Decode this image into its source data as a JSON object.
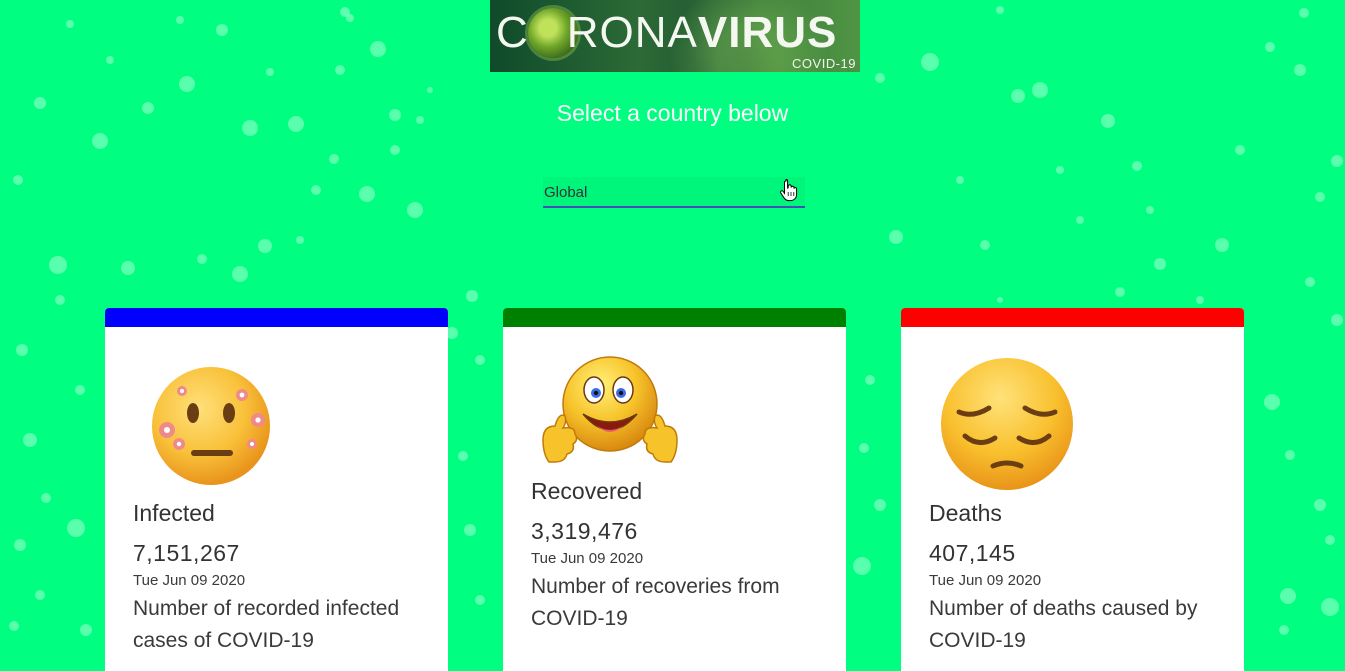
{
  "logo": {
    "title_thin": "C",
    "title_mid": "RONA",
    "title_bold": "VIRUS",
    "subtitle": "COVID-19"
  },
  "heading": "Select a country below",
  "country_select": {
    "selected": "Global"
  },
  "cards": [
    {
      "label": "Infected",
      "count": "7,151,267",
      "date": "Tue Jun 09 2020",
      "description": "Number of recorded infected cases of COVID-19",
      "accent": "#0000ff",
      "icon": "sick-face-emoji-icon"
    },
    {
      "label": "Recovered",
      "count": "3,319,476",
      "date": "Tue Jun 09 2020",
      "description": "Number of recoveries from COVID-19",
      "accent": "#008000",
      "icon": "thumbs-up-smiley-icon"
    },
    {
      "label": "Deaths",
      "count": "407,145",
      "date": "Tue Jun 09 2020",
      "description": "Number of deaths caused by COVID-19",
      "accent": "#ff0000",
      "icon": "pensive-face-emoji-icon"
    }
  ]
}
